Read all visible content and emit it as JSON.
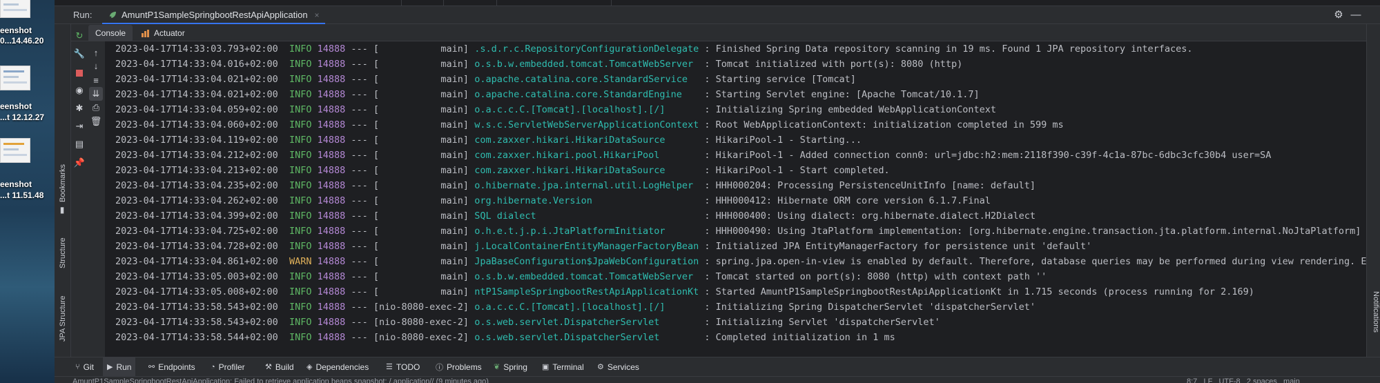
{
  "desktop": {
    "items": [
      {
        "line1": "eenshot",
        "line2": "0...14.46.20"
      },
      {
        "line1": "eenshot",
        "line2": "...t 12.12.27"
      },
      {
        "line1": "eenshot",
        "line2": "...t 11.51.48"
      }
    ]
  },
  "run_panel": {
    "label": "Run:",
    "tab_title": "AmuntP1SampleSpringbootRestApiApplication",
    "tab_close": "×",
    "console_tab": "Console",
    "actuator_tab": "Actuator"
  },
  "left_sidebar": {
    "bookmarks": "Bookmarks",
    "structure": "Structure",
    "jpa_structure": "JPA Structure"
  },
  "right_sidebar": {
    "notifications": "Notifications"
  },
  "log_lines": [
    {
      "ts": "2023-04-17T14:33:03.793+02:00",
      "level": "INFO",
      "pid": "14888",
      "thread": "           main",
      "logger": ".s.d.r.c.RepositoryConfigurationDelegate",
      "msg": " : Finished Spring Data repository scanning in 19 ms. Found 1 JPA repository interfaces."
    },
    {
      "ts": "2023-04-17T14:33:04.016+02:00",
      "level": "INFO",
      "pid": "14888",
      "thread": "           main",
      "logger": "o.s.b.w.embedded.tomcat.TomcatWebServer ",
      "msg": " : Tomcat initialized with port(s): 8080 (http)"
    },
    {
      "ts": "2023-04-17T14:33:04.021+02:00",
      "level": "INFO",
      "pid": "14888",
      "thread": "           main",
      "logger": "o.apache.catalina.core.StandardService  ",
      "msg": " : Starting service [Tomcat]"
    },
    {
      "ts": "2023-04-17T14:33:04.021+02:00",
      "level": "INFO",
      "pid": "14888",
      "thread": "           main",
      "logger": "o.apache.catalina.core.StandardEngine   ",
      "msg": " : Starting Servlet engine: [Apache Tomcat/10.1.7]"
    },
    {
      "ts": "2023-04-17T14:33:04.059+02:00",
      "level": "INFO",
      "pid": "14888",
      "thread": "           main",
      "logger": "o.a.c.c.C.[Tomcat].[localhost].[/]      ",
      "msg": " : Initializing Spring embedded WebApplicationContext"
    },
    {
      "ts": "2023-04-17T14:33:04.060+02:00",
      "level": "INFO",
      "pid": "14888",
      "thread": "           main",
      "logger": "w.s.c.ServletWebServerApplicationContext",
      "msg": " : Root WebApplicationContext: initialization completed in 599 ms"
    },
    {
      "ts": "2023-04-17T14:33:04.119+02:00",
      "level": "INFO",
      "pid": "14888",
      "thread": "           main",
      "logger": "com.zaxxer.hikari.HikariDataSource      ",
      "msg": " : HikariPool-1 - Starting..."
    },
    {
      "ts": "2023-04-17T14:33:04.212+02:00",
      "level": "INFO",
      "pid": "14888",
      "thread": "           main",
      "logger": "com.zaxxer.hikari.pool.HikariPool       ",
      "msg": " : HikariPool-1 - Added connection conn0: url=jdbc:h2:mem:2118f390-c39f-4c1a-87bc-6dbc3cfc30b4 user=SA"
    },
    {
      "ts": "2023-04-17T14:33:04.213+02:00",
      "level": "INFO",
      "pid": "14888",
      "thread": "           main",
      "logger": "com.zaxxer.hikari.HikariDataSource      ",
      "msg": " : HikariPool-1 - Start completed."
    },
    {
      "ts": "2023-04-17T14:33:04.235+02:00",
      "level": "INFO",
      "pid": "14888",
      "thread": "           main",
      "logger": "o.hibernate.jpa.internal.util.LogHelper ",
      "msg": " : HHH000204: Processing PersistenceUnitInfo [name: default]"
    },
    {
      "ts": "2023-04-17T14:33:04.262+02:00",
      "level": "INFO",
      "pid": "14888",
      "thread": "           main",
      "logger": "org.hibernate.Version                   ",
      "msg": " : HHH000412: Hibernate ORM core version 6.1.7.Final"
    },
    {
      "ts": "2023-04-17T14:33:04.399+02:00",
      "level": "INFO",
      "pid": "14888",
      "thread": "           main",
      "logger": "SQL dialect                             ",
      "msg": " : HHH000400: Using dialect: org.hibernate.dialect.H2Dialect"
    },
    {
      "ts": "2023-04-17T14:33:04.725+02:00",
      "level": "INFO",
      "pid": "14888",
      "thread": "           main",
      "logger": "o.h.e.t.j.p.i.JtaPlatformInitiator      ",
      "msg": " : HHH000490: Using JtaPlatform implementation: [org.hibernate.engine.transaction.jta.platform.internal.NoJtaPlatform]"
    },
    {
      "ts": "2023-04-17T14:33:04.728+02:00",
      "level": "INFO",
      "pid": "14888",
      "thread": "           main",
      "logger": "j.LocalContainerEntityManagerFactoryBean",
      "msg": " : Initialized JPA EntityManagerFactory for persistence unit 'default'"
    },
    {
      "ts": "2023-04-17T14:33:04.861+02:00",
      "level": "WARN",
      "pid": "14888",
      "thread": "           main",
      "logger": "JpaBaseConfiguration$JpaWebConfiguration",
      "msg": " : spring.jpa.open-in-view is enabled by default. Therefore, database queries may be performed during view rendering. Expl"
    },
    {
      "ts": "2023-04-17T14:33:05.003+02:00",
      "level": "INFO",
      "pid": "14888",
      "thread": "           main",
      "logger": "o.s.b.w.embedded.tomcat.TomcatWebServer ",
      "msg": " : Tomcat started on port(s): 8080 (http) with context path ''"
    },
    {
      "ts": "2023-04-17T14:33:05.008+02:00",
      "level": "INFO",
      "pid": "14888",
      "thread": "           main",
      "logger": "ntP1SampleSpringbootRestApiApplicationKt",
      "msg": " : Started AmuntP1SampleSpringbootRestApiApplicationKt in 1.715 seconds (process running for 2.169)"
    },
    {
      "ts": "2023-04-17T14:33:58.543+02:00",
      "level": "INFO",
      "pid": "14888",
      "thread": "nio-8080-exec-2",
      "logger": "o.a.c.c.C.[Tomcat].[localhost].[/]      ",
      "msg": " : Initializing Spring DispatcherServlet 'dispatcherServlet'"
    },
    {
      "ts": "2023-04-17T14:33:58.543+02:00",
      "level": "INFO",
      "pid": "14888",
      "thread": "nio-8080-exec-2",
      "logger": "o.s.web.servlet.DispatcherServlet       ",
      "msg": " : Initializing Servlet 'dispatcherServlet'"
    },
    {
      "ts": "2023-04-17T14:33:58.544+02:00",
      "level": "INFO",
      "pid": "14888",
      "thread": "nio-8080-exec-2",
      "logger": "o.s.web.servlet.DispatcherServlet       ",
      "msg": " : Completed initialization in 1 ms"
    }
  ],
  "bottom_tabs": {
    "git": "Git",
    "run": "Run",
    "endpoints": "Endpoints",
    "profiler": "Profiler",
    "build": "Build",
    "dependencies": "Dependencies",
    "todo": "TODO",
    "problems": "Problems",
    "spring": "Spring",
    "terminal": "Terminal",
    "services": "Services"
  },
  "status_bar": {
    "message": "AmuntP1SampleSpringbootRestApiApplication: Failed to retrieve application beans snapshot: /.application// (9 minutes ago)",
    "position": "8:7",
    "line_sep": "LF",
    "encoding": "UTF-8",
    "indent": "2 spaces",
    "branch": "main"
  },
  "colors": {
    "accent": "#3574f0",
    "info": "#5fb865",
    "warn": "#e0b15a",
    "pid": "#b589d6",
    "logger": "#2fbdb0",
    "stop": "#db5c5c",
    "rerun": "#5fb865"
  },
  "icons": {
    "run_tab": "spring-leaf-icon",
    "settings": "gear-icon",
    "minimize": "minimize-icon"
  }
}
